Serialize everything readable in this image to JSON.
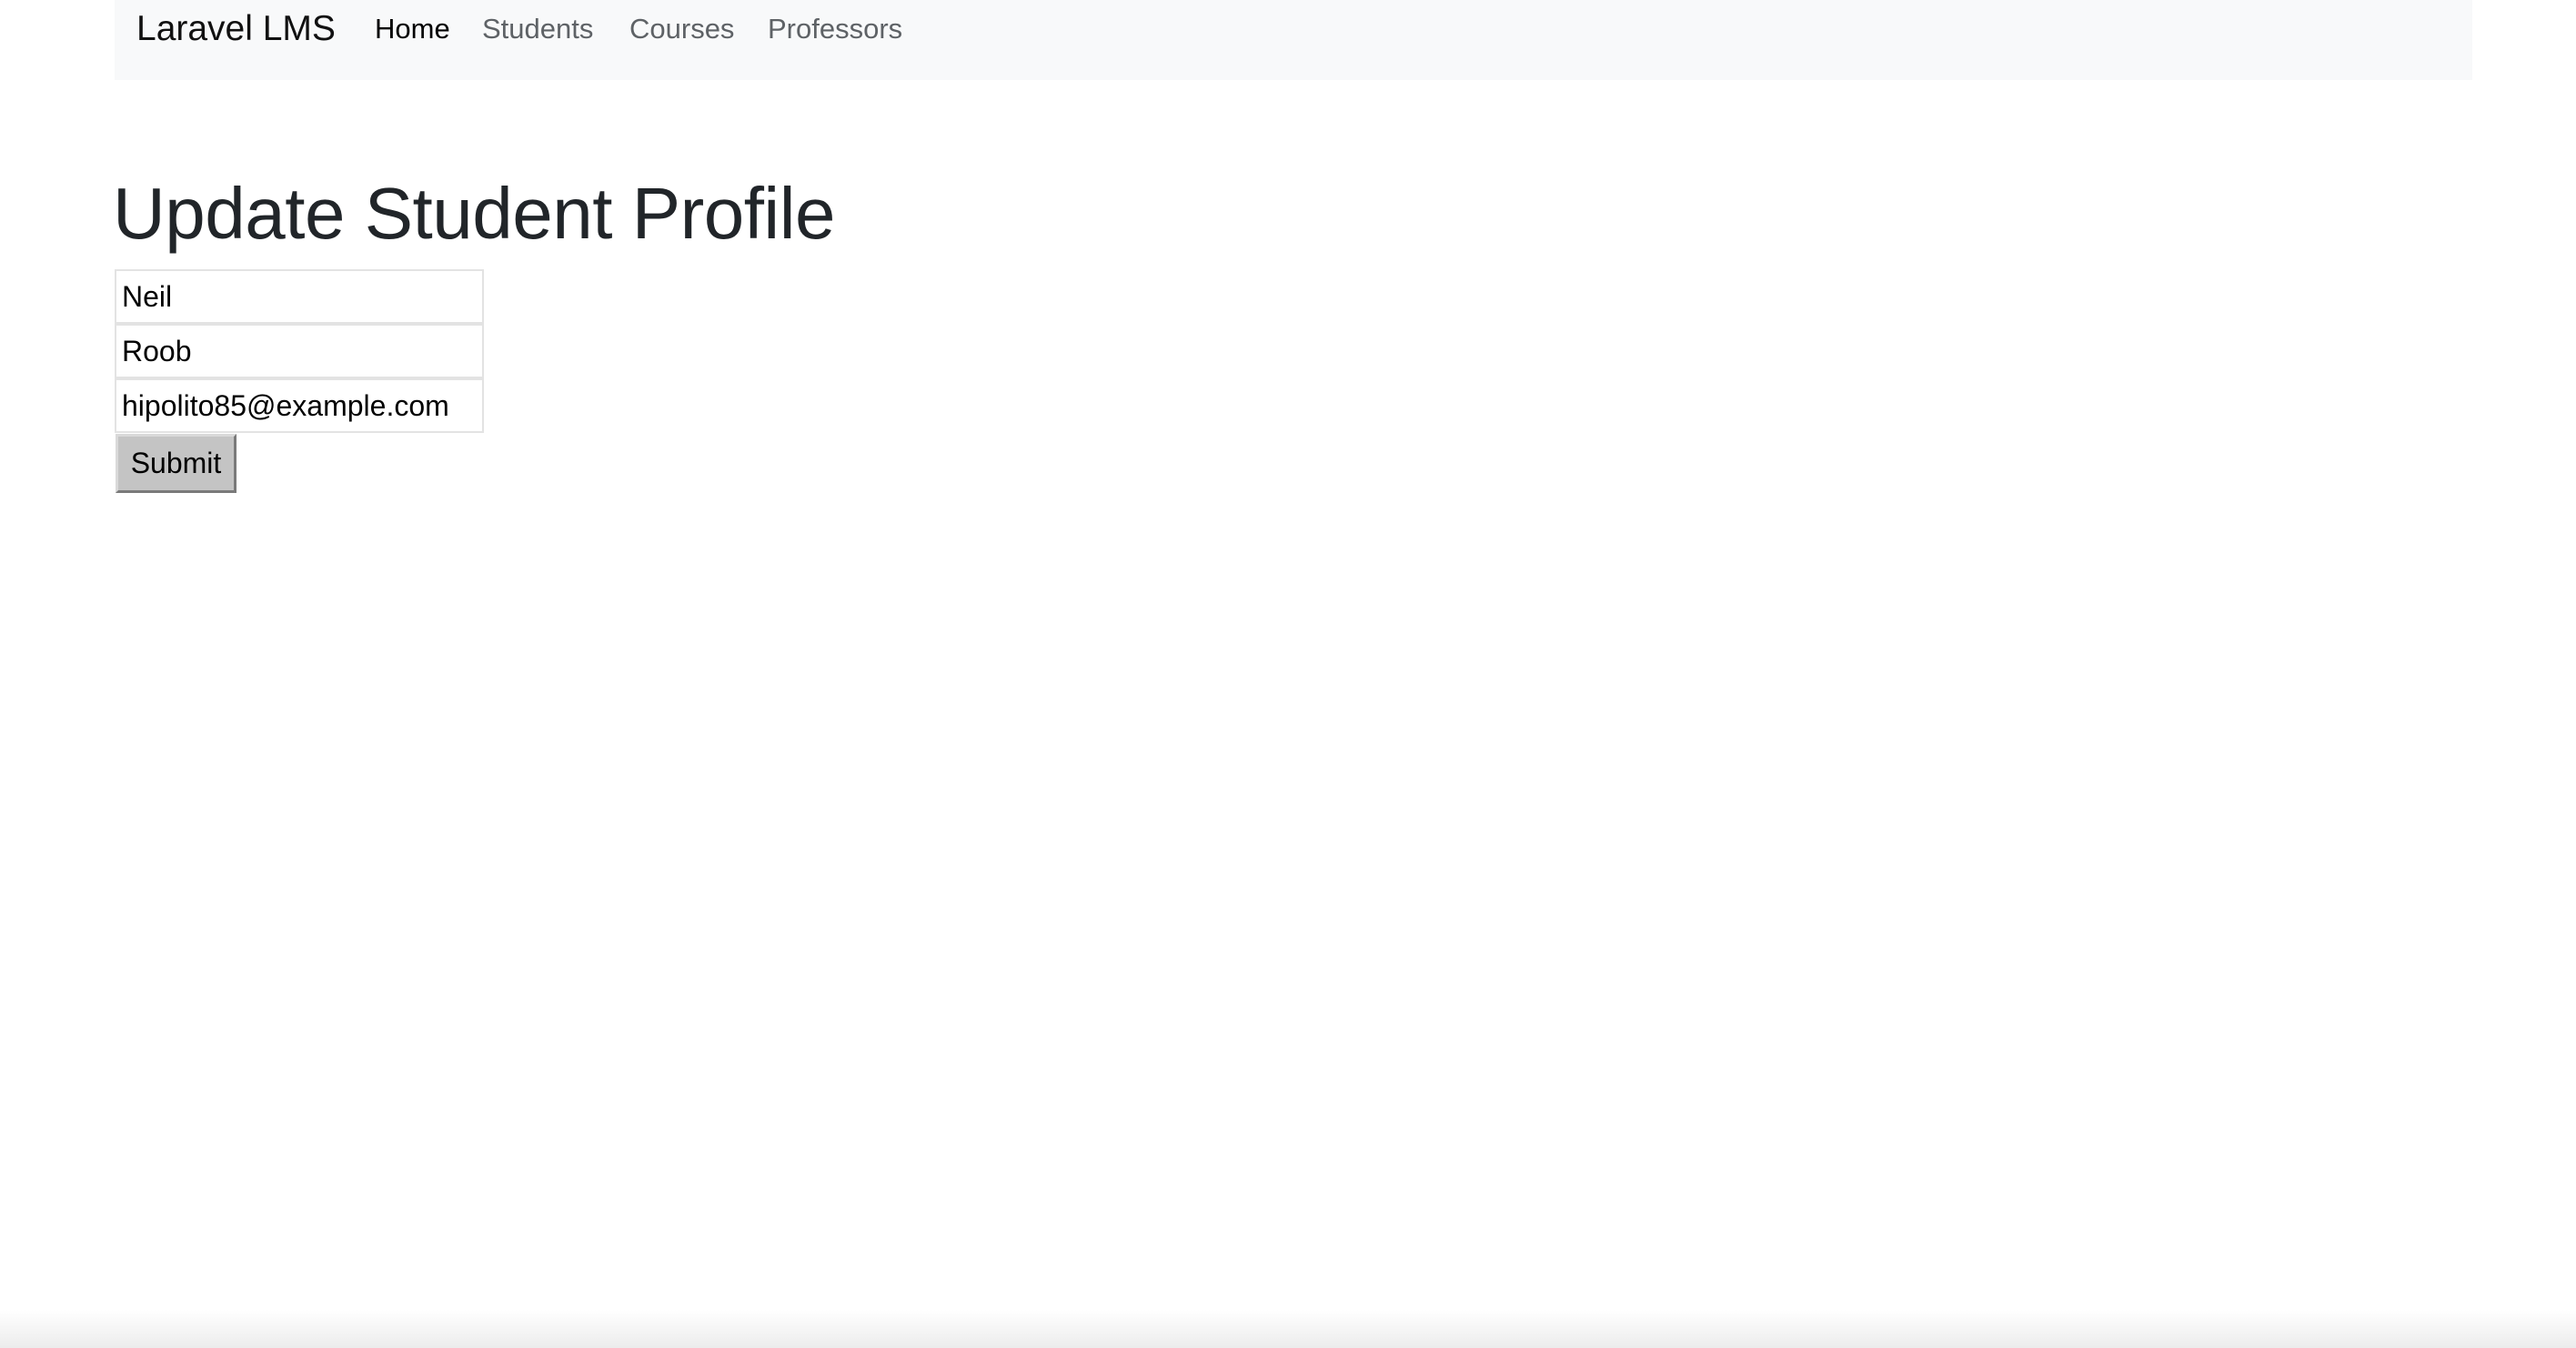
{
  "navbar": {
    "brand": "Laravel LMS",
    "links": [
      {
        "label": "Home",
        "active": true
      },
      {
        "label": "Students",
        "active": false
      },
      {
        "label": "Courses",
        "active": false
      },
      {
        "label": "Professors",
        "active": false
      }
    ]
  },
  "main": {
    "title": "Update Student Profile",
    "form": {
      "first_name": "Neil",
      "last_name": "Roob",
      "email": "hipolito85@example.com",
      "submit_label": "Submit"
    }
  },
  "colors": {
    "navbar_bg": "#f8f9fa",
    "title": "#212529",
    "nav_inactive": "#5e6266",
    "button_bg": "#c4c4c4"
  }
}
